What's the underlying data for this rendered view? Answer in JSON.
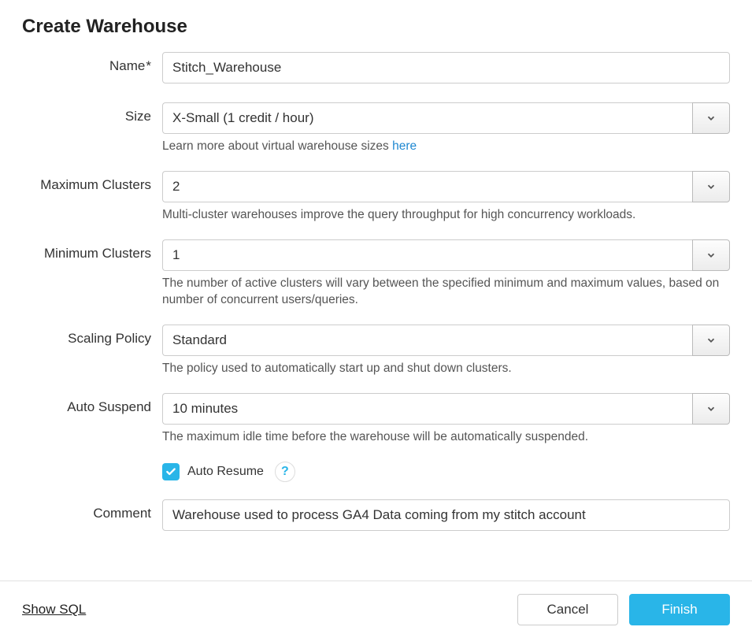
{
  "dialog": {
    "title": "Create Warehouse"
  },
  "form": {
    "name": {
      "label": "Name",
      "required_mark": "*",
      "value": "Stitch_Warehouse"
    },
    "size": {
      "label": "Size",
      "value": "X-Small  (1 credit / hour)",
      "help_text": "Learn more about virtual warehouse sizes ",
      "help_link": "here"
    },
    "max_clusters": {
      "label": "Maximum Clusters",
      "value": "2",
      "help_text": "Multi-cluster warehouses improve the query throughput for high concurrency workloads."
    },
    "min_clusters": {
      "label": "Minimum Clusters",
      "value": "1",
      "help_text": "The number of active clusters will vary between the specified minimum and maximum values, based on number of concurrent users/queries."
    },
    "scaling_policy": {
      "label": "Scaling Policy",
      "value": "Standard",
      "help_text": "The policy used to automatically start up and shut down clusters."
    },
    "auto_suspend": {
      "label": "Auto Suspend",
      "value": "10 minutes",
      "help_text": "The maximum idle time before the warehouse will be automatically suspended."
    },
    "auto_resume": {
      "label": "Auto Resume",
      "checked": true,
      "help_glyph": "?"
    },
    "comment": {
      "label": "Comment",
      "value": "Warehouse used to process GA4 Data coming from my stitch account"
    }
  },
  "footer": {
    "show_sql": "Show SQL",
    "cancel": "Cancel",
    "finish": "Finish"
  }
}
